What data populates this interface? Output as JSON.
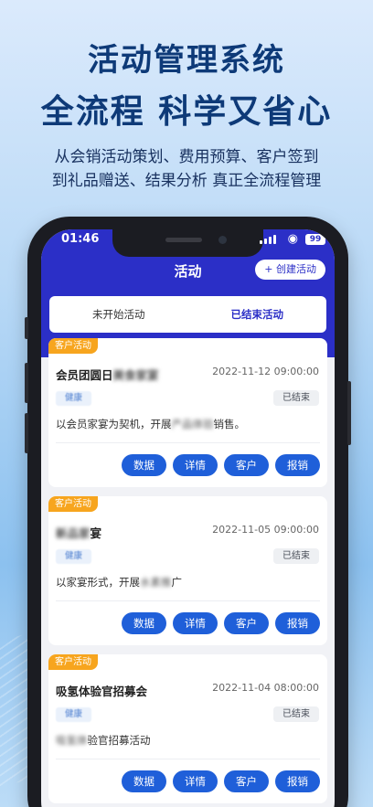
{
  "hero": {
    "line1": "活动管理系统",
    "line2": "全流程 科学又省心",
    "sub1": "从会销活动策划、费用预算、客户签到",
    "sub2": "到礼品赠送、结果分析 真正全流程管理"
  },
  "status_bar": {
    "time": "01:46",
    "battery": "99"
  },
  "app": {
    "title": "活动",
    "create_button": "+ 创建活动",
    "tabs": [
      {
        "label": "未开始活动"
      },
      {
        "label": "已结束活动"
      }
    ],
    "cards": [
      {
        "tag": "客户活动",
        "title_clear": "会员团圆日",
        "title_blur": "美食家宴",
        "date": "2022-11-12 09:00:00",
        "chip": "健康",
        "status": "已结束",
        "desc_clear": "以会员家宴为契机，开展",
        "desc_blur": "产品体验",
        "desc_end": "销售。",
        "buttons": [
          "数据",
          "详情",
          "客户",
          "报销"
        ]
      },
      {
        "tag": "客户活动",
        "title_blur": "新品家",
        "title_clear": "宴",
        "date": "2022-11-05 09:00:00",
        "chip": "健康",
        "status": "已结束",
        "desc_clear": "以家宴形式，开展",
        "desc_blur": "水素推",
        "desc_end": "广",
        "buttons": [
          "数据",
          "详情",
          "客户",
          "报销"
        ]
      },
      {
        "tag": "客户活动",
        "title_clear": "吸氢体验官招募会",
        "date": "2022-11-04 08:00:00",
        "chip": "健康",
        "status": "已结束",
        "desc_blur": "吸氢体",
        "desc_clear": "验官招募活动",
        "buttons": [
          "数据",
          "详情",
          "客户",
          "报销"
        ]
      }
    ]
  }
}
